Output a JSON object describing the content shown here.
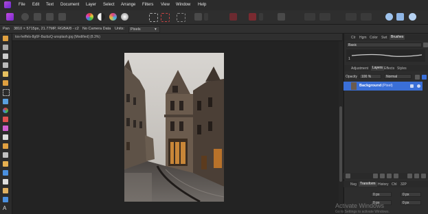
{
  "menu": [
    "File",
    "Edit",
    "Text",
    "Document",
    "Layer",
    "Select",
    "Arrange",
    "Filters",
    "View",
    "Window",
    "Help"
  ],
  "context_bar": {
    "tool": "Pan",
    "image_info": "3810 × 5715px, 21.77MP, RGBA/8 - c2",
    "camera": "No Camera Data",
    "units_label": "Units:",
    "units_value": "Pixels"
  },
  "document": {
    "tab_title": "tos-heffels-8g6F-8azbzQ-unsplash.jpg [Modified] (8.3%)"
  },
  "right_panel": {
    "top_tabs": [
      "Clr",
      "Hgm",
      "Color",
      "Swt",
      "Brushes"
    ],
    "active_top_tab": "Brushes",
    "brush_category": "Basic",
    "brush_size": "1",
    "mid_tabs": [
      "Adjustment",
      "Layers",
      "Effects",
      "Styles"
    ],
    "active_mid_tab": "Layers",
    "opacity_label": "Opacity",
    "opacity_value": "100 %",
    "blend_mode": "Normal",
    "layer_name": "Background",
    "layer_type": "(Pixel)",
    "bottom_tabs": [
      "Nvg",
      "Transform",
      "History",
      "Chl",
      "32P"
    ],
    "active_bottom_tab": "Transform",
    "transform_x": "0 px",
    "transform_y": "0 px",
    "transform_w": "0 px",
    "transform_h": "0 px"
  },
  "watermark": {
    "title": "Activate Windows",
    "subtitle": "Go to Settings to activate Windows."
  },
  "colors": {
    "accent": "#3a6fd8",
    "app_bg": "#222222"
  }
}
